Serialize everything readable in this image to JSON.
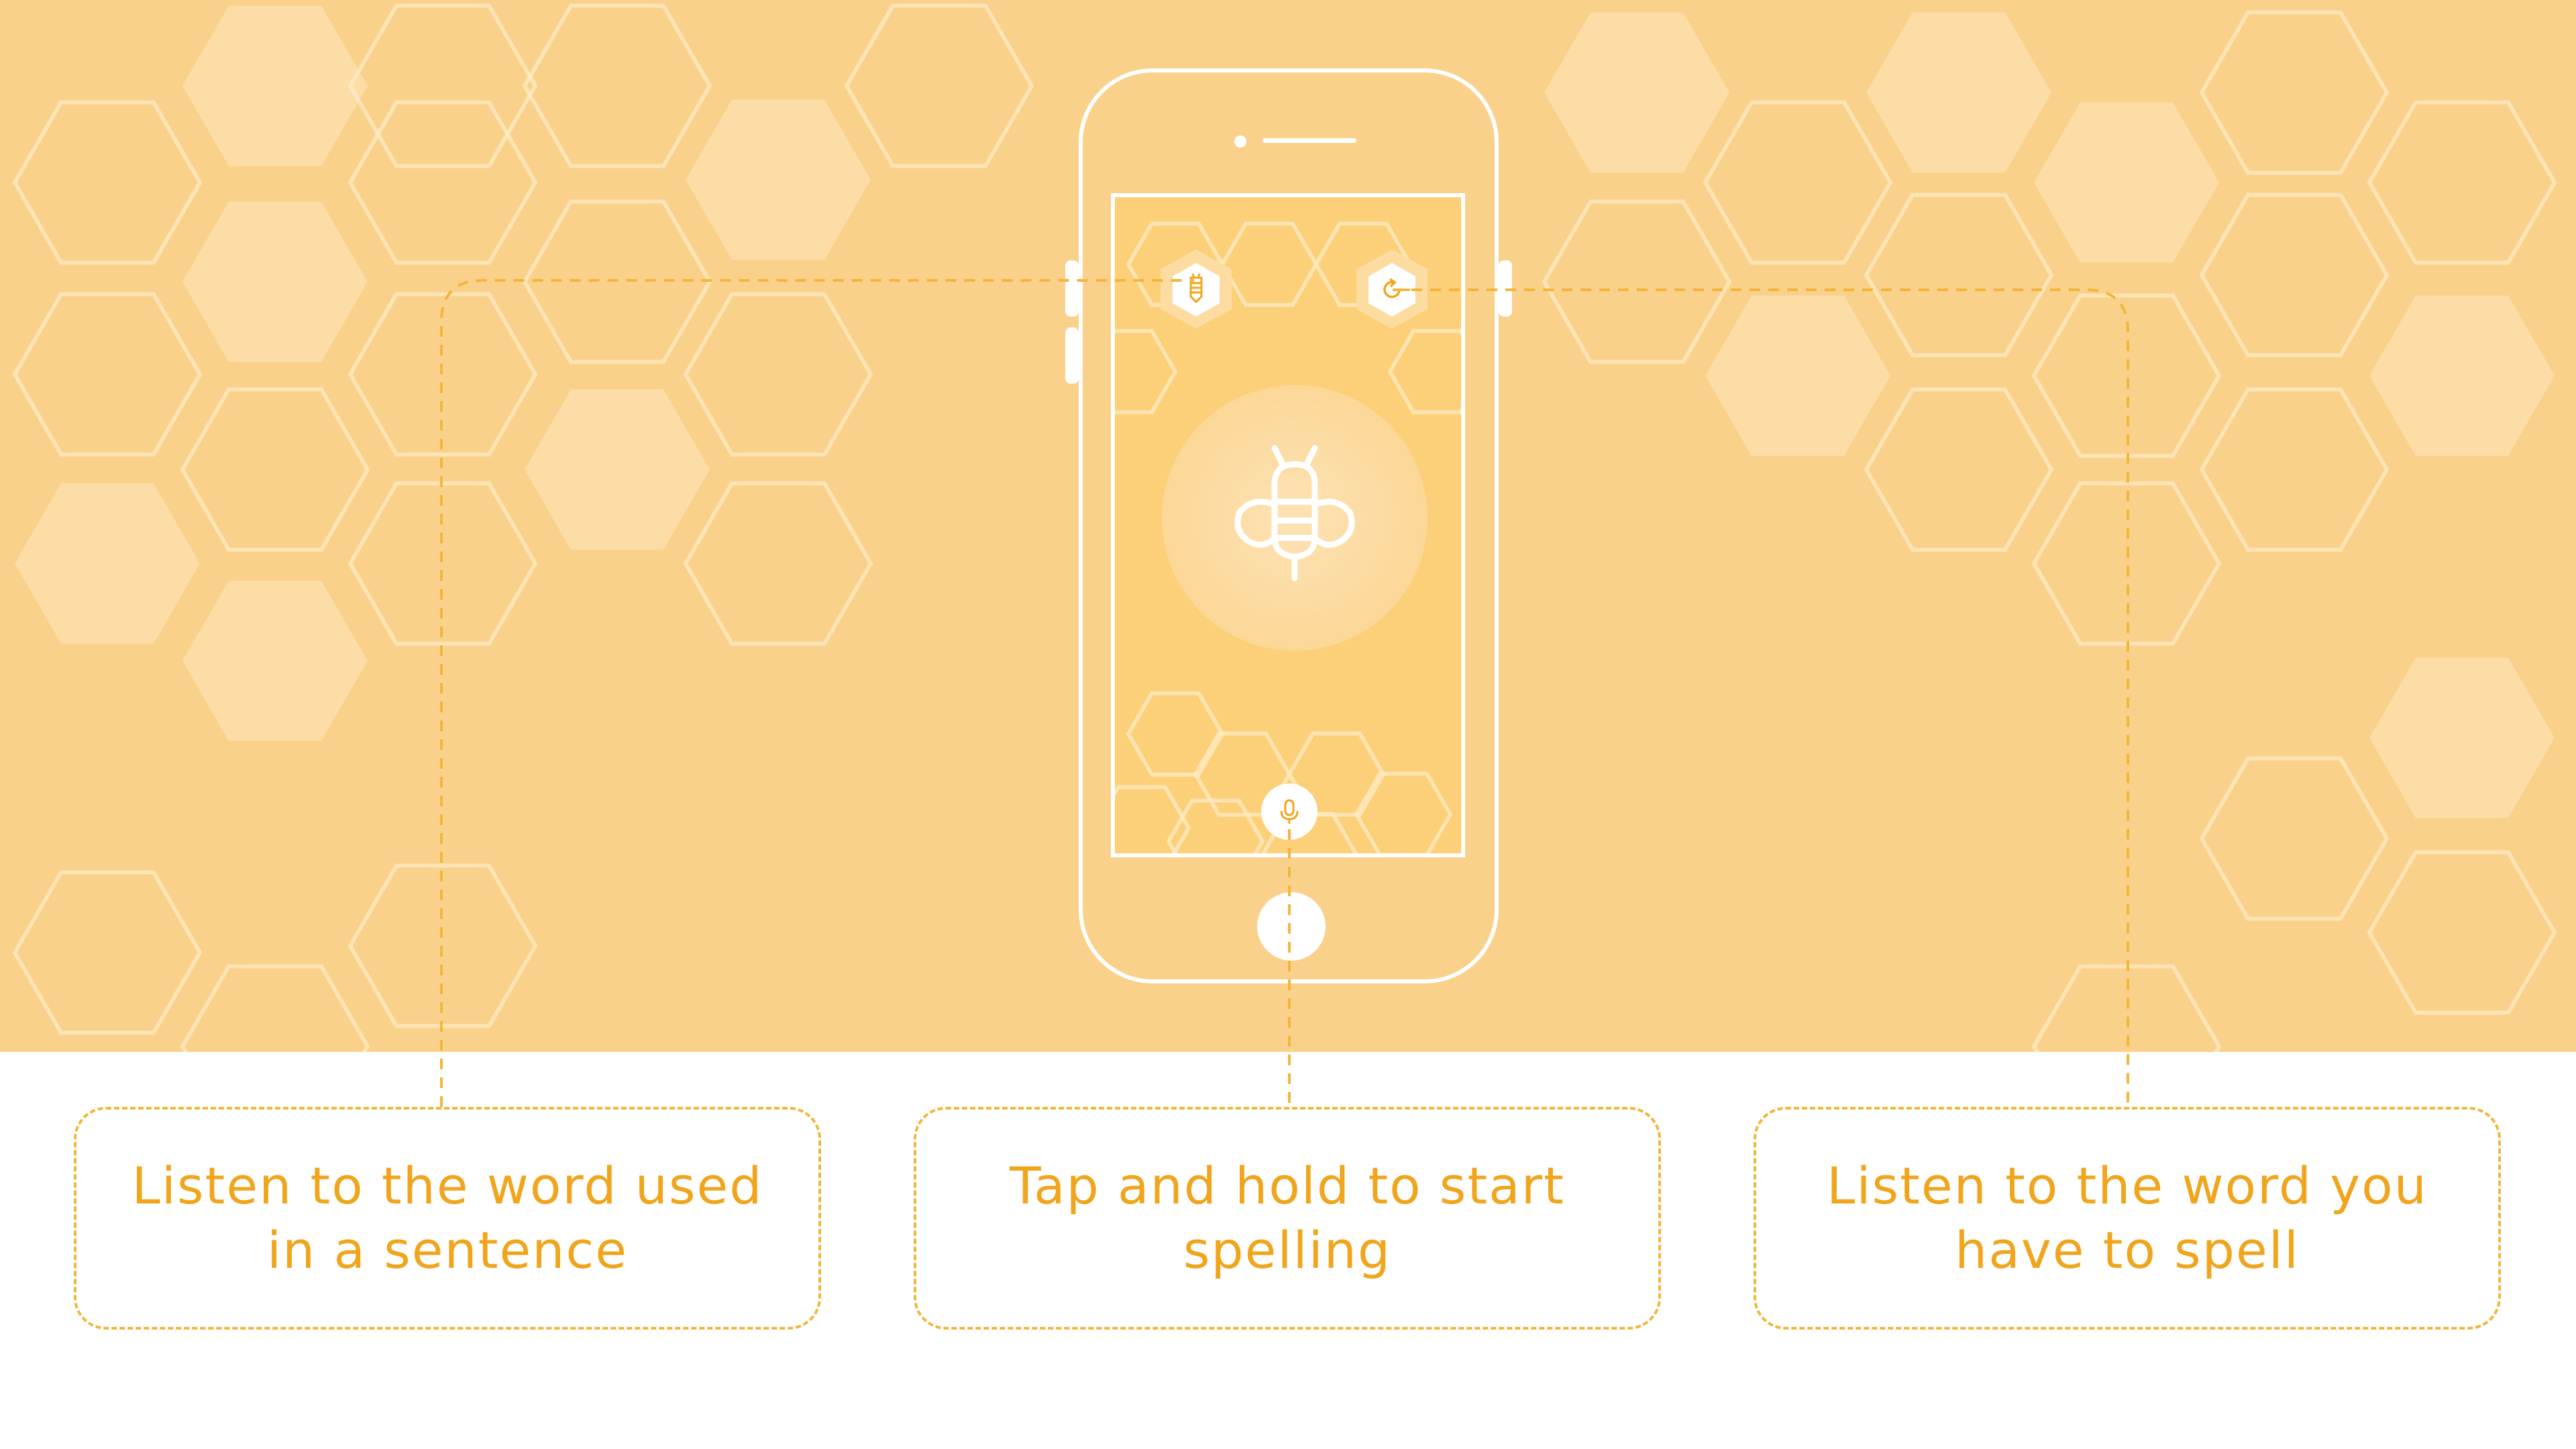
{
  "colors": {
    "background": "#f9d18a",
    "screen": "#fccf79",
    "accent": "#f0a51d",
    "dashed_line": "#f3b63a",
    "white": "#ffffff"
  },
  "phone": {
    "icons": {
      "sentence_button": "sentence-speech-icon",
      "replay_button": "replay-speech-icon",
      "center": "bee-icon",
      "mic": "microphone-icon"
    }
  },
  "callouts": [
    {
      "text": "Listen to the word used in a sentence"
    },
    {
      "text": "Tap and hold to start spelling"
    },
    {
      "text": "Listen to the word you have to spell"
    }
  ]
}
